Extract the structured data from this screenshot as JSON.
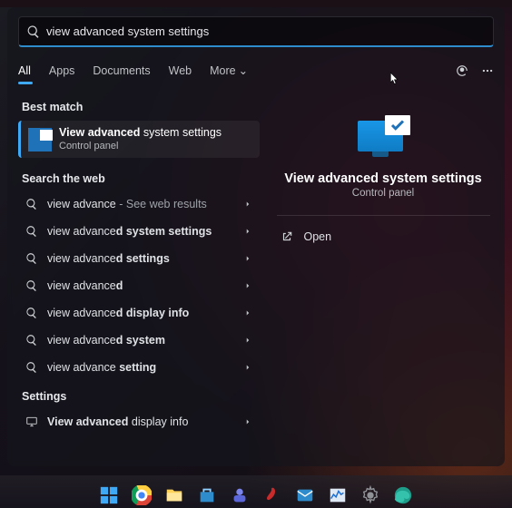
{
  "search": {
    "query": "view advanced system settings"
  },
  "tabs": [
    "All",
    "Apps",
    "Documents",
    "Web",
    "More"
  ],
  "best_match": {
    "header": "Best match",
    "title_strong": "View advanced",
    "title_rest": " system settings",
    "subtitle": "Control panel"
  },
  "web": {
    "header": "Search the web",
    "items": [
      {
        "text_html": "view advance",
        "hint": " - See web results"
      },
      {
        "text_html": "view advance<b>d system settings</b>"
      },
      {
        "text_html": "view advance<b>d settings</b>"
      },
      {
        "text_html": "view advance<b>d</b>"
      },
      {
        "text_html": "view advance<b>d display info</b>"
      },
      {
        "text_html": "view advance<b>d system</b>"
      },
      {
        "text_html": "view advance <b>setting</b>"
      }
    ]
  },
  "settings": {
    "header": "Settings",
    "items": [
      {
        "text_html": "<b>View advanced</b> display info"
      }
    ]
  },
  "detail": {
    "title": "View advanced system settings",
    "subtitle": "Control panel",
    "open": "Open"
  },
  "taskbar": [
    "start",
    "chrome",
    "explorer",
    "store",
    "teams",
    "media",
    "mail",
    "photos",
    "settings",
    "edge"
  ]
}
